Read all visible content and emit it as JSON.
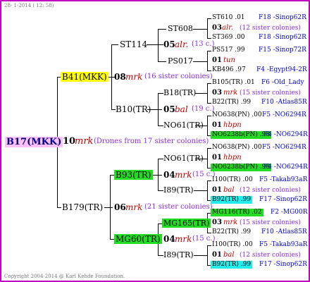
{
  "header": {
    "date_line": "28- 1-2014 ( 12: 58)"
  },
  "footer": {
    "copyright": "Copyright 2004-2014 @ Karl Kehde Foundation."
  },
  "root": {
    "id": "B17(MKK)",
    "gen_num": "10",
    "gen_mrk": "mrk",
    "desc": "(Drones from 17 sister colonies)"
  },
  "g1": [
    {
      "id": "B41(MKK)",
      "gen_num": "08",
      "gen_mrk": "mrk",
      "desc": "(16 sister colonies)"
    },
    {
      "id": "B179(TR)",
      "gen_num": "06",
      "gen_mrk": "mrk",
      "desc": "(21 sister colonies)"
    }
  ],
  "g2": [
    {
      "id": "ST114",
      "gen_num": "05",
      "gen_mrk": "alr.",
      "desc": "(13 c.)"
    },
    {
      "id": "B10(TR)",
      "gen_num": "05",
      "gen_mrk": "bal",
      "desc": "(19 c.)"
    },
    {
      "id": "B93(TR)",
      "gen_num": "04",
      "gen_mrk": "mrk",
      "desc": "(15 c.)"
    },
    {
      "id": "MG60(TR)",
      "gen_num": "04",
      "gen_mrk": "mrk",
      "desc": "(15 c.)"
    }
  ],
  "g3": [
    {
      "id": "ST608"
    },
    {
      "id": "PS017"
    },
    {
      "id": "B18(TR)"
    },
    {
      "id": "NO61(TR)"
    },
    {
      "id": "NO61(TR)"
    },
    {
      "id": "I89(TR)"
    },
    {
      "id": "MG165(TR)"
    },
    {
      "id": "I89(TR)"
    }
  ],
  "g4": [
    {
      "top": "ST610 .01",
      "top_code": "F18 -Sinop62R",
      "num": "03",
      "mrk": "alr.",
      "desc": "(12 sister colonies)",
      "bot": "ST369 .00",
      "bot_code": "F18 -Sinop62R"
    },
    {
      "top": "PS517 .99",
      "top_code": "F15 -Sinop72R",
      "num": "01",
      "mrk": "tun",
      "desc": "",
      "bot": "KB496 .97",
      "bot_code": "F4 -Egypt94-2R"
    },
    {
      "top": "B105(TR) .01",
      "top_code": "F6 -Old_Lady",
      "num": "03",
      "mrk": "mrk",
      "desc": "(15 sister colonies)",
      "bot": "B22(TR) .99",
      "bot_code": "F10 -Atlas85R"
    },
    {
      "top": "NO638(PN) .00",
      "top_code": "F5 -NO6294R",
      "num": "01",
      "mrk": "hbpn",
      "desc": "",
      "bot": "NO6238b(PN) .98",
      "bot_code": "F4 -NO6294R"
    },
    {
      "top": "NO638(PN) .00",
      "top_code": "F5 -NO6294R",
      "num": "01",
      "mrk": "hbpn",
      "desc": "",
      "bot": "NO6238b(PN) .98",
      "bot_code": "F4 -NO6294R"
    },
    {
      "top": "I100(TR) .00",
      "top_code": "F5 -Takab93aR",
      "num": "01",
      "mrk": "bal",
      "desc": "(12 sister colonies)",
      "bot": "B92(TR) .99",
      "bot_code": "F17 -Sinop62R"
    },
    {
      "top": "MG116(TR) .02",
      "top_code": "F2 -MG00R",
      "num": "03",
      "mrk": "mrk",
      "desc": "(15 sister colonies)",
      "bot": "B22(TR) .99",
      "bot_code": "F10 -Atlas85R"
    },
    {
      "top": "I100(TR) .00",
      "top_code": "F5 -Takab93aR",
      "num": "01",
      "mrk": "bal",
      "desc": "(12 sister colonies)",
      "bot": "B92(TR) .99",
      "bot_code": "F17 -Sinop62R"
    }
  ]
}
